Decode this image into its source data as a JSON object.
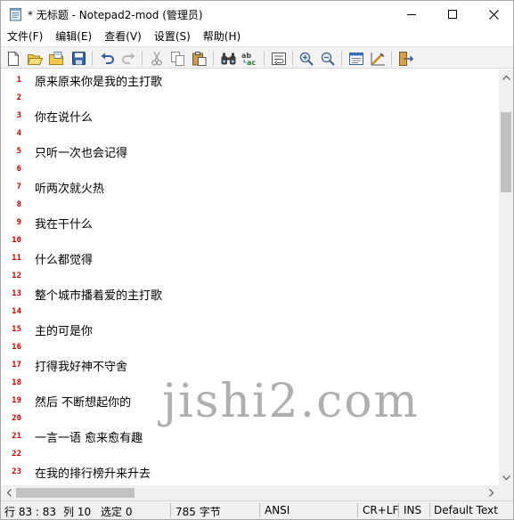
{
  "window": {
    "title": "* 无标题 - Notepad2-mod (管理员)"
  },
  "menu": [
    {
      "id": "file",
      "label": "文件(F)"
    },
    {
      "id": "edit",
      "label": "编辑(E)"
    },
    {
      "id": "view",
      "label": "查看(V)"
    },
    {
      "id": "settings",
      "label": "设置(S)"
    },
    {
      "id": "help",
      "label": "帮助(H)"
    }
  ],
  "toolbar": {
    "icons": [
      "new-file-icon",
      "open-folder-icon",
      "browse-icon",
      "save-icon",
      "undo-icon",
      "redo-icon",
      "cut-icon",
      "copy-icon",
      "paste-icon",
      "find-icon",
      "replace-icon",
      "word-wrap-icon",
      "zoom-in-icon",
      "zoom-out-icon",
      "scheme-icon",
      "customize-scheme-icon",
      "exit-icon"
    ]
  },
  "editor": {
    "lines": [
      {
        "num": "1",
        "text": "原来原来你是我的主打歌"
      },
      {
        "num": "2",
        "text": ""
      },
      {
        "num": "3",
        "text": "你在说什么"
      },
      {
        "num": "4",
        "text": ""
      },
      {
        "num": "5",
        "text": "只听一次也会记得"
      },
      {
        "num": "6",
        "text": ""
      },
      {
        "num": "7",
        "text": "听两次就火热"
      },
      {
        "num": "8",
        "text": ""
      },
      {
        "num": "9",
        "text": "我在干什么"
      },
      {
        "num": "10",
        "text": ""
      },
      {
        "num": "11",
        "text": "什么都觉得"
      },
      {
        "num": "12",
        "text": ""
      },
      {
        "num": "13",
        "text": "整个城市播着爱的主打歌"
      },
      {
        "num": "14",
        "text": ""
      },
      {
        "num": "15",
        "text": "主的可是你"
      },
      {
        "num": "16",
        "text": ""
      },
      {
        "num": "17",
        "text": "打得我好神不守舍"
      },
      {
        "num": "18",
        "text": ""
      },
      {
        "num": "19",
        "text": "然后 不断想起你的"
      },
      {
        "num": "20",
        "text": ""
      },
      {
        "num": "21",
        "text": "一言一语 愈来愈有趣"
      },
      {
        "num": "22",
        "text": ""
      },
      {
        "num": "23",
        "text": "在我的排行榜升来升去"
      }
    ]
  },
  "statusbar": {
    "position": "行 83 : 83",
    "column": "列 10",
    "selection": "选定 0",
    "size": "785 字节",
    "encoding": "ANSI",
    "line_ending": "CR+LF",
    "insert_mode": "INS",
    "scheme": "Default Text"
  },
  "watermark": "jishi2.com",
  "colors": {
    "line_number": "#d00000",
    "toolbar_bg": "#f3f3f3",
    "status_bg": "#f0f0f0"
  }
}
